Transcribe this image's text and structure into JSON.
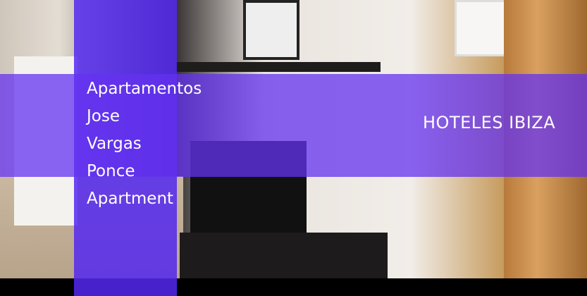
{
  "title_lines": [
    "Apartamentos",
    "Jose",
    "Vargas",
    "Ponce",
    "Apartment"
  ],
  "brand": "HOTELES IBIZA",
  "colors": {
    "overlay": "#5428f0",
    "text": "#ffffff"
  }
}
